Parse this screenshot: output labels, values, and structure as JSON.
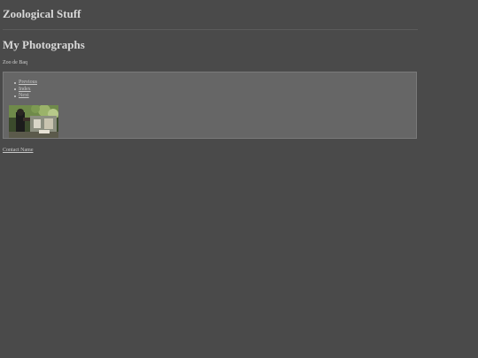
{
  "header": {
    "site_title": "Zoological Stuff"
  },
  "main": {
    "title": "My Photographs",
    "subtitle": "Zoo de Baq"
  },
  "gallery": {
    "nav": [
      {
        "label": "Previous"
      },
      {
        "label": "Index"
      },
      {
        "label": "Next"
      }
    ],
    "photo_alt": "zoo photograph thumbnail"
  },
  "footer": {
    "contact_label": "Contact Name"
  },
  "colors": {
    "background": "#4a4a4a",
    "panel": "#666666",
    "text": "#d4d4d4"
  }
}
